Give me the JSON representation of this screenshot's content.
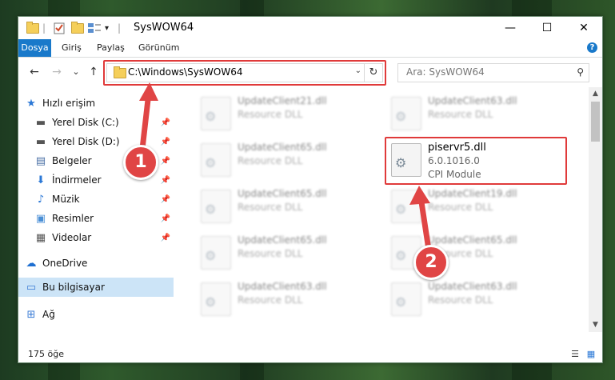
{
  "window": {
    "title": "SysWOW64",
    "minimize_glyph": "—",
    "maximize_glyph": "☐",
    "close_glyph": "✕"
  },
  "quick_access_toolbar": {
    "icons": [
      "folder-icon",
      "properties-icon",
      "new-folder-icon",
      "customize-icon"
    ],
    "dropdown_glyph": "▾"
  },
  "ribbon": {
    "tabs": [
      "Dosya",
      "Giriş",
      "Paylaş",
      "Görünüm"
    ],
    "active_tab": "Dosya",
    "help_glyph": "?"
  },
  "navigation": {
    "back_glyph": "←",
    "forward_glyph": "→",
    "recent_glyph": "⌄",
    "up_glyph": "↑",
    "address": "C:\\Windows\\SysWOW64",
    "address_dropdown_glyph": "⌄",
    "refresh_glyph": "↻",
    "search_placeholder": "Ara: SysWOW64",
    "search_glyph": "⚲"
  },
  "sidebar": {
    "items": [
      {
        "label": "Hızlı erişim",
        "icon": "star-icon",
        "glyph": "★",
        "color": "#2b78d6",
        "pinned": false,
        "selected": false
      },
      {
        "label": "Yerel Disk (C:)",
        "icon": "drive-icon",
        "glyph": "▬",
        "color": "#555555",
        "pinned": true,
        "selected": false
      },
      {
        "label": "Yerel Disk (D:)",
        "icon": "drive-icon",
        "glyph": "▬",
        "color": "#555555",
        "pinned": true,
        "selected": false
      },
      {
        "label": "Belgeler",
        "icon": "documents-icon",
        "glyph": "▤",
        "color": "#4a6fa5",
        "pinned": true,
        "selected": false
      },
      {
        "label": "İndirmeler",
        "icon": "downloads-icon",
        "glyph": "⬇",
        "color": "#2b78d6",
        "pinned": true,
        "selected": false
      },
      {
        "label": "Müzik",
        "icon": "music-icon",
        "glyph": "♪",
        "color": "#2b78d6",
        "pinned": true,
        "selected": false
      },
      {
        "label": "Resimler",
        "icon": "pictures-icon",
        "glyph": "▣",
        "color": "#4a8fd6",
        "pinned": true,
        "selected": false
      },
      {
        "label": "Videolar",
        "icon": "videos-icon",
        "glyph": "▦",
        "color": "#555555",
        "pinned": true,
        "selected": false
      },
      {
        "label": "OneDrive",
        "icon": "onedrive-icon",
        "glyph": "☁",
        "color": "#1e6fd1",
        "pinned": false,
        "selected": false
      },
      {
        "label": "Bu bilgisayar",
        "icon": "computer-icon",
        "glyph": "▭",
        "color": "#3a7bd5",
        "pinned": false,
        "selected": true
      },
      {
        "label": "Ağ",
        "icon": "network-icon",
        "glyph": "⊞",
        "color": "#3a7bd5",
        "pinned": false,
        "selected": false
      }
    ],
    "pin_glyph": "📌"
  },
  "files": {
    "left_column": [
      {
        "name": "UpdateClient21.dll",
        "desc": "Resource DLL"
      },
      {
        "name": "UpdateClient65.dll",
        "desc": "Resource DLL"
      },
      {
        "name": "UpdateClient65.dll",
        "desc": "Resource DLL"
      },
      {
        "name": "UpdateClient65.dll",
        "desc": "Resource DLL"
      },
      {
        "name": "UpdateClient63.dll",
        "desc": "Resource DLL"
      }
    ],
    "right_column": [
      {
        "name": "UpdateClient63.dll",
        "desc": "Resource DLL"
      },
      {
        "name": "UpdateClient19.dll",
        "desc": "Resource DLL"
      },
      {
        "name": "UpdateClient65.dll",
        "desc": "Resource DLL"
      },
      {
        "name": "UpdateClient63.dll",
        "desc": "Resource DLL"
      }
    ],
    "highlighted": {
      "name": "piservr5.dll",
      "version": "6.0.1016.0",
      "desc": "CPI Module"
    }
  },
  "scrollbar": {
    "up_glyph": "▲",
    "down_glyph": "▼"
  },
  "status": {
    "item_count": "175 öğe",
    "details_view_glyph": "☰",
    "icons_view_glyph": "▦"
  },
  "callouts": {
    "step1": "1",
    "step2": "2",
    "color": "#e04545"
  }
}
